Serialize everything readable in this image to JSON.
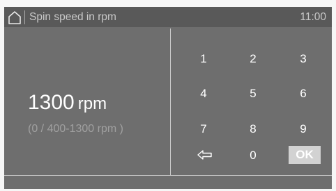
{
  "header": {
    "title": "Spin speed in rpm",
    "time": "11:00",
    "home_icon": "home-icon"
  },
  "display": {
    "value": "1300",
    "unit": "rpm",
    "range": "(0 / 400-1300 rpm     )"
  },
  "keypad": {
    "keys": [
      "1",
      "2",
      "3",
      "4",
      "5",
      "6",
      "7",
      "8",
      "9"
    ],
    "zero": "0",
    "ok": "OK",
    "back_icon": "backspace-arrow-icon"
  },
  "colors": {
    "background": "#6e6e6e",
    "header": "#595959",
    "ok_button": "#d2d2d2"
  }
}
